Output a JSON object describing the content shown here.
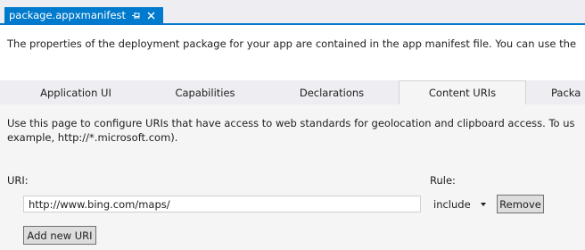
{
  "document_tab": {
    "title": "package.appxmanifest",
    "pin_glyph": "pin-icon",
    "close_glyph": "close-icon"
  },
  "description": "The properties of the deployment package for your app are contained in the app manifest file. You can use the",
  "designer_tabs": [
    {
      "label": "Application UI",
      "active": false
    },
    {
      "label": "Capabilities",
      "active": false
    },
    {
      "label": "Declarations",
      "active": false
    },
    {
      "label": "Content URIs",
      "active": true
    },
    {
      "label": "Packa",
      "active": false
    }
  ],
  "content_uris": {
    "help_line1": "Use this page to configure URIs that have access to web standards for geolocation and clipboard access. To us",
    "help_line2": "example, http://*.microsoft.com).",
    "uri_label": "URI:",
    "rule_label": "Rule:",
    "uri_value": "http://www.bing.com/maps/",
    "rule_value": "include",
    "remove_label": "Remove",
    "add_label": "Add new URI"
  },
  "colors": {
    "accent": "#007acc",
    "tab_strip": "#eeeef2",
    "page_background": "#f5f5f5"
  }
}
